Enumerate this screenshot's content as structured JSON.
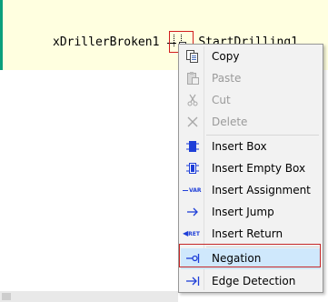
{
  "editor": {
    "variable_name": "xDrillerBroken1",
    "trailing_text": "StartDrilling1"
  },
  "context_menu": {
    "items": [
      {
        "label": "Copy",
        "icon": "copy-icon",
        "enabled": true
      },
      {
        "label": "Paste",
        "icon": "paste-icon",
        "enabled": false
      },
      {
        "label": "Cut",
        "icon": "cut-icon",
        "enabled": false
      },
      {
        "label": "Delete",
        "icon": "delete-icon",
        "enabled": false
      },
      {
        "label": "Insert Box",
        "icon": "insert-box-icon",
        "enabled": true
      },
      {
        "label": "Insert Empty Box",
        "icon": "insert-empty-box-icon",
        "enabled": true
      },
      {
        "label": "Insert Assignment",
        "icon": "insert-assignment-icon",
        "enabled": true,
        "icon_text": "VAR"
      },
      {
        "label": "Insert Jump",
        "icon": "insert-jump-icon",
        "enabled": true
      },
      {
        "label": "Insert Return",
        "icon": "insert-return-icon",
        "enabled": true,
        "icon_text": "RET"
      },
      {
        "label": "Negation",
        "icon": "negation-icon",
        "enabled": true,
        "selected": true
      },
      {
        "label": "Edge Detection",
        "icon": "edge-detection-icon",
        "enabled": true
      }
    ]
  },
  "colors": {
    "editor_background": "#ffffe0",
    "editor_border": "#0aa07c",
    "highlight_border": "#c62828",
    "selected_item": "#cfe8fc",
    "icon_blue": "#1f3fd8"
  }
}
